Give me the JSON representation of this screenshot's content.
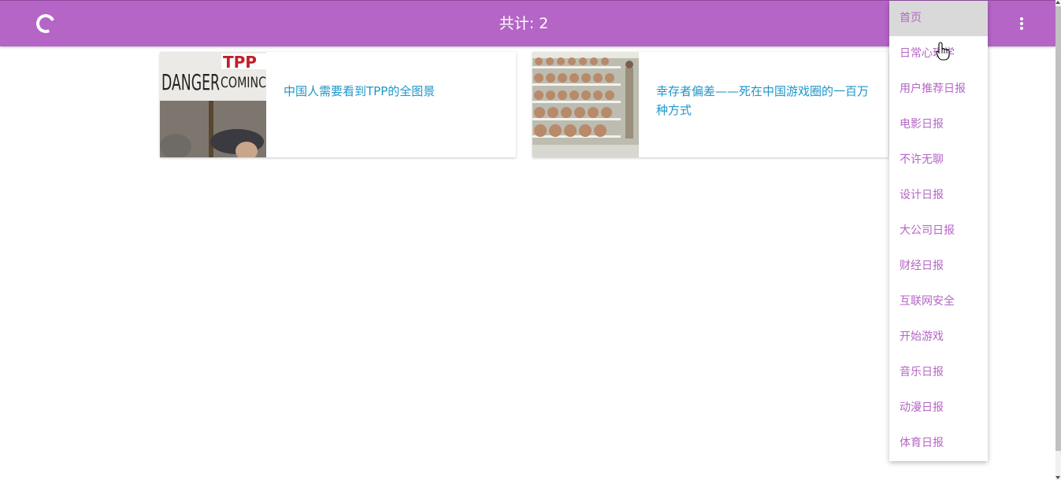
{
  "appbar": {
    "spinner_icon": "loading-spinner-icon",
    "title": "共计: 2",
    "more_icon": "more-vert-icon",
    "color": "#b565c6"
  },
  "articles": [
    {
      "title": "中国人需要看到TPP的全图景",
      "image_text_1": "DANGER",
      "image_text_2": "TPP",
      "image_text_3": "COMINC"
    },
    {
      "title": "幸存者偏差——死在中国游戏圈的一百万种方式"
    }
  ],
  "menu": {
    "items": [
      {
        "label": "首页",
        "active": true
      },
      {
        "label": "日常心理学"
      },
      {
        "label": "用户推荐日报"
      },
      {
        "label": "电影日报"
      },
      {
        "label": "不许无聊"
      },
      {
        "label": "设计日报"
      },
      {
        "label": "大公司日报"
      },
      {
        "label": "财经日报"
      },
      {
        "label": "互联网安全"
      },
      {
        "label": "开始游戏"
      },
      {
        "label": "音乐日报"
      },
      {
        "label": "动漫日报"
      },
      {
        "label": "体育日报"
      }
    ]
  },
  "colors": {
    "accent": "#b565c6",
    "link": "#1e96c8"
  }
}
